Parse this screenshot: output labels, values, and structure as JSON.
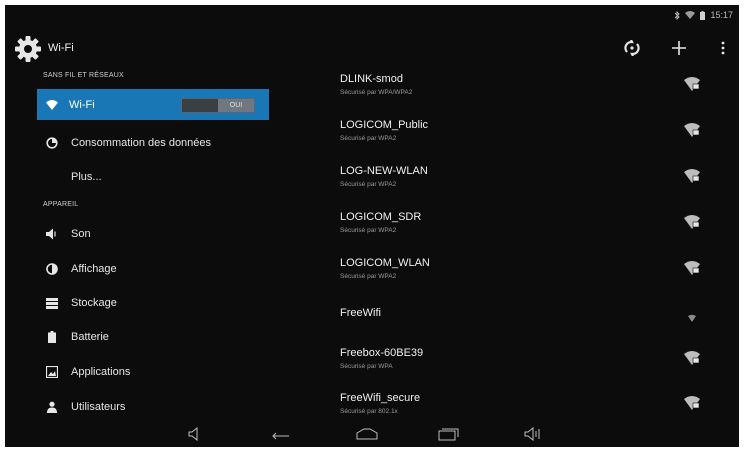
{
  "status_bar": {
    "time": "15:17"
  },
  "action_bar": {
    "title": "Wi-Fi"
  },
  "left_panel": {
    "section_wireless": "SANS FIL ET RÉSEAUX",
    "wifi_item": {
      "label": "Wi-Fi",
      "toggle": "OUI"
    },
    "data_usage": "Consommation des données",
    "more": "Plus...",
    "section_device": "APPAREIL",
    "sound": "Son",
    "display": "Affichage",
    "storage": "Stockage",
    "battery": "Batterie",
    "apps": "Applications",
    "users": "Utilisateurs"
  },
  "networks": [
    {
      "ssid": "DLINK-smod",
      "security": "Sécurisé par WPA/WPA2",
      "locked": true
    },
    {
      "ssid": "LOGICOM_Public",
      "security": "Sécurisé par WPA2",
      "locked": true
    },
    {
      "ssid": "LOG-NEW-WLAN",
      "security": "Sécurisé par WPA2",
      "locked": true
    },
    {
      "ssid": "LOGICOM_SDR",
      "security": "Sécurisé par WPA2",
      "locked": true
    },
    {
      "ssid": "LOGICOM_WLAN",
      "security": "Sécurisé par WPA2",
      "locked": true
    },
    {
      "ssid": "FreeWifi",
      "security": "",
      "locked": false
    },
    {
      "ssid": "Freebox-60BE39",
      "security": "Sécurisé par WPA",
      "locked": true
    },
    {
      "ssid": "FreeWifi_secure",
      "security": "Sécurisé par 802.1x",
      "locked": true
    }
  ],
  "icons": {
    "settings": "gear-icon",
    "wps": "wps-icon",
    "add": "plus-icon",
    "overflow": "overflow-menu-icon",
    "wifi": "wifi-icon",
    "data": "data-usage-icon",
    "sound": "speaker-icon",
    "display": "brightness-icon",
    "storage": "storage-icon",
    "battery": "battery-icon",
    "apps": "apps-icon",
    "users": "user-icon"
  },
  "colors": {
    "accent": "#1a77b5",
    "background": "#0c0c0c"
  }
}
